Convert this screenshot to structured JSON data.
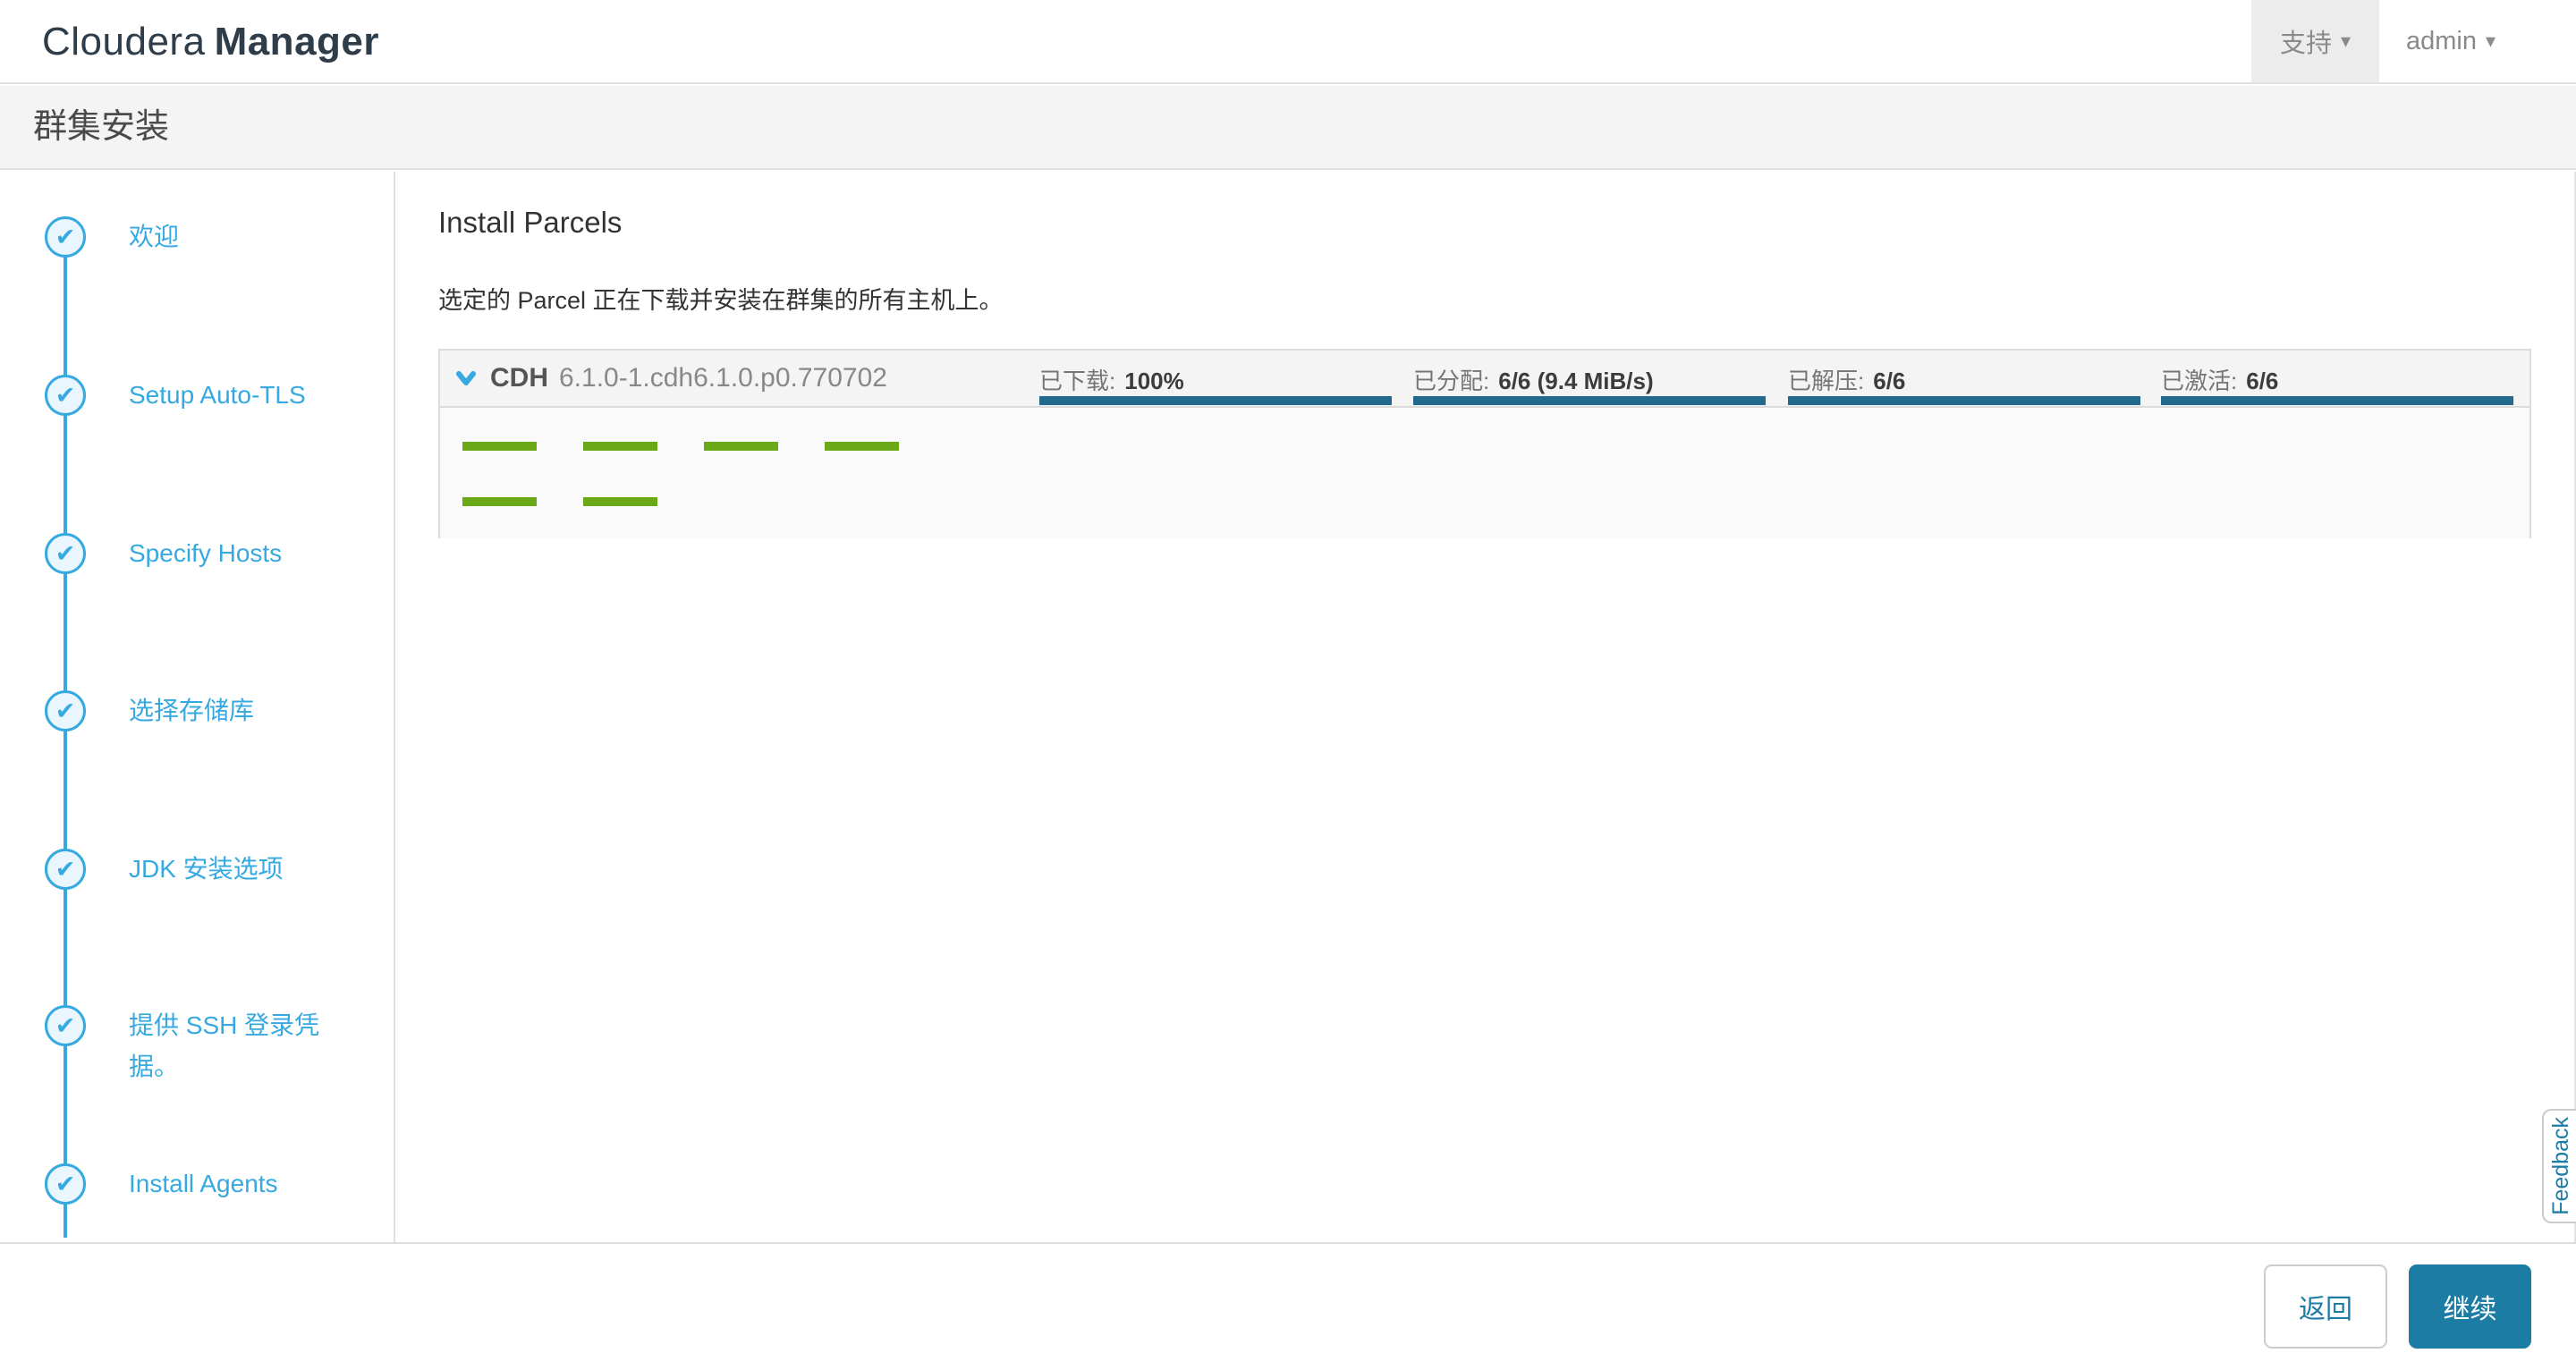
{
  "header": {
    "logo_brand": "Cloudera",
    "logo_product": "Manager",
    "support_label": "支持",
    "user_label": "admin",
    "caret": "▾"
  },
  "page_title": "群集安装",
  "wizard": {
    "steps": [
      {
        "label": "欢迎",
        "done": true
      },
      {
        "label": "Setup Auto-TLS",
        "done": true
      },
      {
        "label": "Specify Hosts",
        "done": true
      },
      {
        "label": "选择存储库",
        "done": true
      },
      {
        "label": "JDK 安装选项",
        "done": true
      },
      {
        "label": "提供 SSH 登录凭据。",
        "done": true
      },
      {
        "label": "Install Agents",
        "done": true
      }
    ],
    "check_glyph": "✔"
  },
  "main": {
    "title": "Install Parcels",
    "description": "选定的 Parcel 正在下载并安装在群集的所有主机上。",
    "parcel": {
      "name": "CDH",
      "version": "6.1.0-1.cdh6.1.0.p0.770702",
      "metrics": [
        {
          "label": "已下载:",
          "value": "100%",
          "progress": 100
        },
        {
          "label": "已分配:",
          "value": "6/6 (9.4 MiB/s)",
          "progress": 100
        },
        {
          "label": "已解压:",
          "value": "6/6",
          "progress": 100
        },
        {
          "label": "已激活:",
          "value": "6/6",
          "progress": 100
        }
      ],
      "host_progress": [
        100,
        100,
        100,
        100,
        100,
        100
      ]
    }
  },
  "footer": {
    "back_label": "返回",
    "continue_label": "继续"
  },
  "feedback_label": "Feedback",
  "colors": {
    "accent_blue": "#36a9e0",
    "progress_teal": "#206b8c",
    "host_green": "#6aa818",
    "button_teal": "#1d7ca4"
  }
}
